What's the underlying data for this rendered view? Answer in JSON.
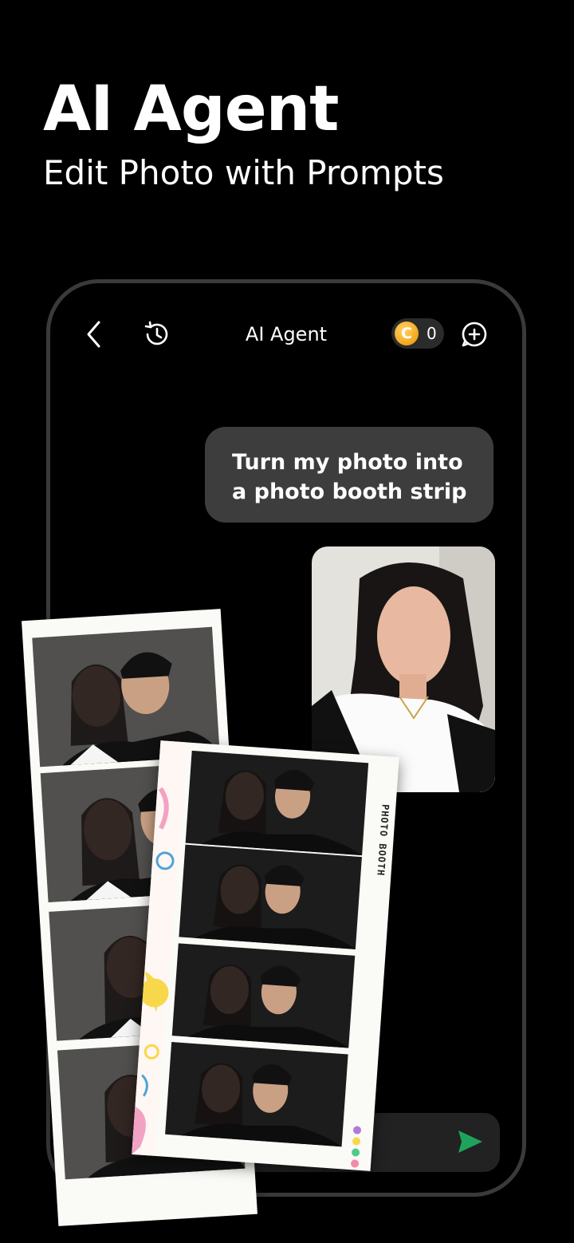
{
  "promo": {
    "headline": "AI Agent",
    "subheadline": "Edit Photo with Prompts"
  },
  "app": {
    "title": "AI Agent",
    "coins": {
      "symbol": "C",
      "count": "0"
    },
    "icons": {
      "back": "chevron-left-icon",
      "history": "history-icon",
      "new_chat": "chat-plus-icon",
      "image": "image-icon",
      "send": "send-icon"
    }
  },
  "chat": {
    "user_message": "Turn my photo into a photo booth strip"
  },
  "strip": {
    "label": "PHOTO BOOTH"
  },
  "colors": {
    "background": "#000000",
    "bubble": "#3d3d3d",
    "coin": "#f3a51d",
    "send": "#1fa35c"
  }
}
